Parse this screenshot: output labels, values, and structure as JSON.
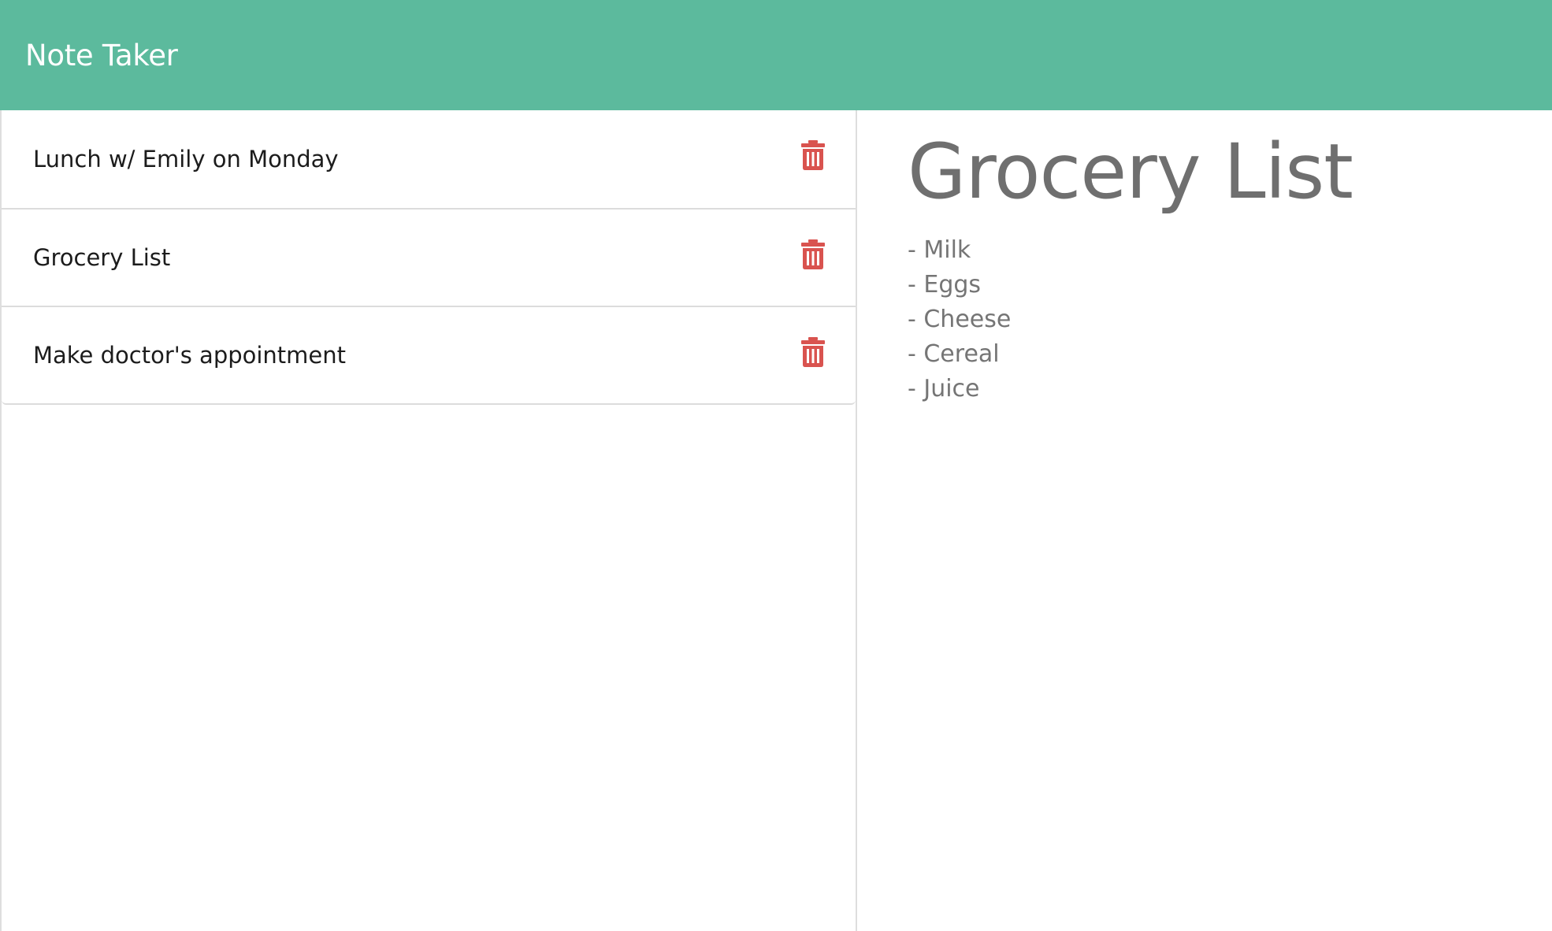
{
  "app": {
    "title": "Note Taker"
  },
  "notes": [
    {
      "title": "Lunch w/ Emily on Monday"
    },
    {
      "title": "Grocery List"
    },
    {
      "title": "Make doctor's appointment"
    }
  ],
  "active_note": {
    "title": "Grocery List",
    "lines": [
      "- Milk",
      "- Eggs",
      "- Cheese",
      "- Cereal",
      "- Juice"
    ]
  },
  "icons": {
    "delete": "trash-icon"
  },
  "colors": {
    "navbar": "#5cba9d",
    "delete_icon": "#d9534f"
  }
}
